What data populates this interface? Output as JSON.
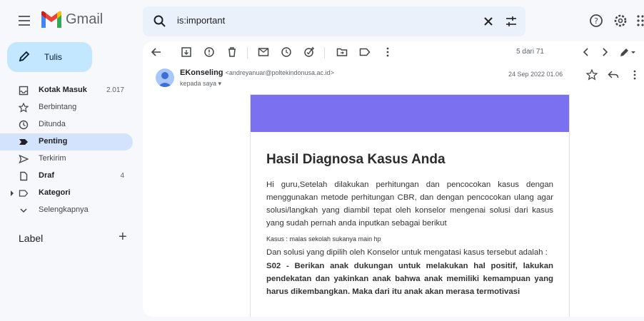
{
  "header": {
    "app_name": "Gmail",
    "search_value": "is:important"
  },
  "sidebar": {
    "compose_label": "Tulis",
    "items": [
      {
        "label": "Kotak Masuk",
        "count": "2.017",
        "icon": "inbox-icon"
      },
      {
        "label": "Berbintang",
        "count": "",
        "icon": "star-icon"
      },
      {
        "label": "Ditunda",
        "count": "",
        "icon": "clock-icon"
      },
      {
        "label": "Penting",
        "count": "",
        "icon": "important-icon"
      },
      {
        "label": "Terkirim",
        "count": "",
        "icon": "send-icon"
      },
      {
        "label": "Draf",
        "count": "4",
        "icon": "draft-icon"
      },
      {
        "label": "Kategori",
        "count": "",
        "icon": "label-icon"
      },
      {
        "label": "Selengkapnya",
        "count": "",
        "icon": "chevron-down-icon"
      }
    ],
    "labels_heading": "Label",
    "labels_add": "+"
  },
  "toolbar": {
    "pager": "5 dari 71"
  },
  "message": {
    "sender_name": "EKonseling",
    "sender_email": "<andreyanuar@poltekindonusa.ac.id>",
    "to_line": "kepada saya ▾",
    "date": "24 Sep 2022 01.06"
  },
  "email": {
    "title": "Hasil Diagnosa Kasus Anda",
    "intro": "Hi guru,Setelah dilakukan perhitungan dan pencocokan kasus dengan menggunakan metode perhitungan CBR, dan dengan pencocokan ulang agar solusi/langkah yang diambil tepat oleh konselor mengenai solusi dari kasus yang sudah pernah anda inputkan sebagai berikut",
    "kasus": "Kasus   : malas sekolah sukanya main hp",
    "solusi_intro": "Dan solusi yang dipilih oleh Konselor untuk mengatasi kasus tersebut adalah :",
    "solusi": "S02 - Berikan anak dukungan untuk melakukan hal positif, lakukan pendekatan dan yakinkan anak bahwa anak memiliki kemampuan yang harus dikembangkan. Maka dari itu anak akan merasa termotivasi"
  },
  "colors": {
    "accent": "#7b70ef",
    "compose_bg": "#c2e7ff",
    "active_bg": "#d3e3fd"
  }
}
